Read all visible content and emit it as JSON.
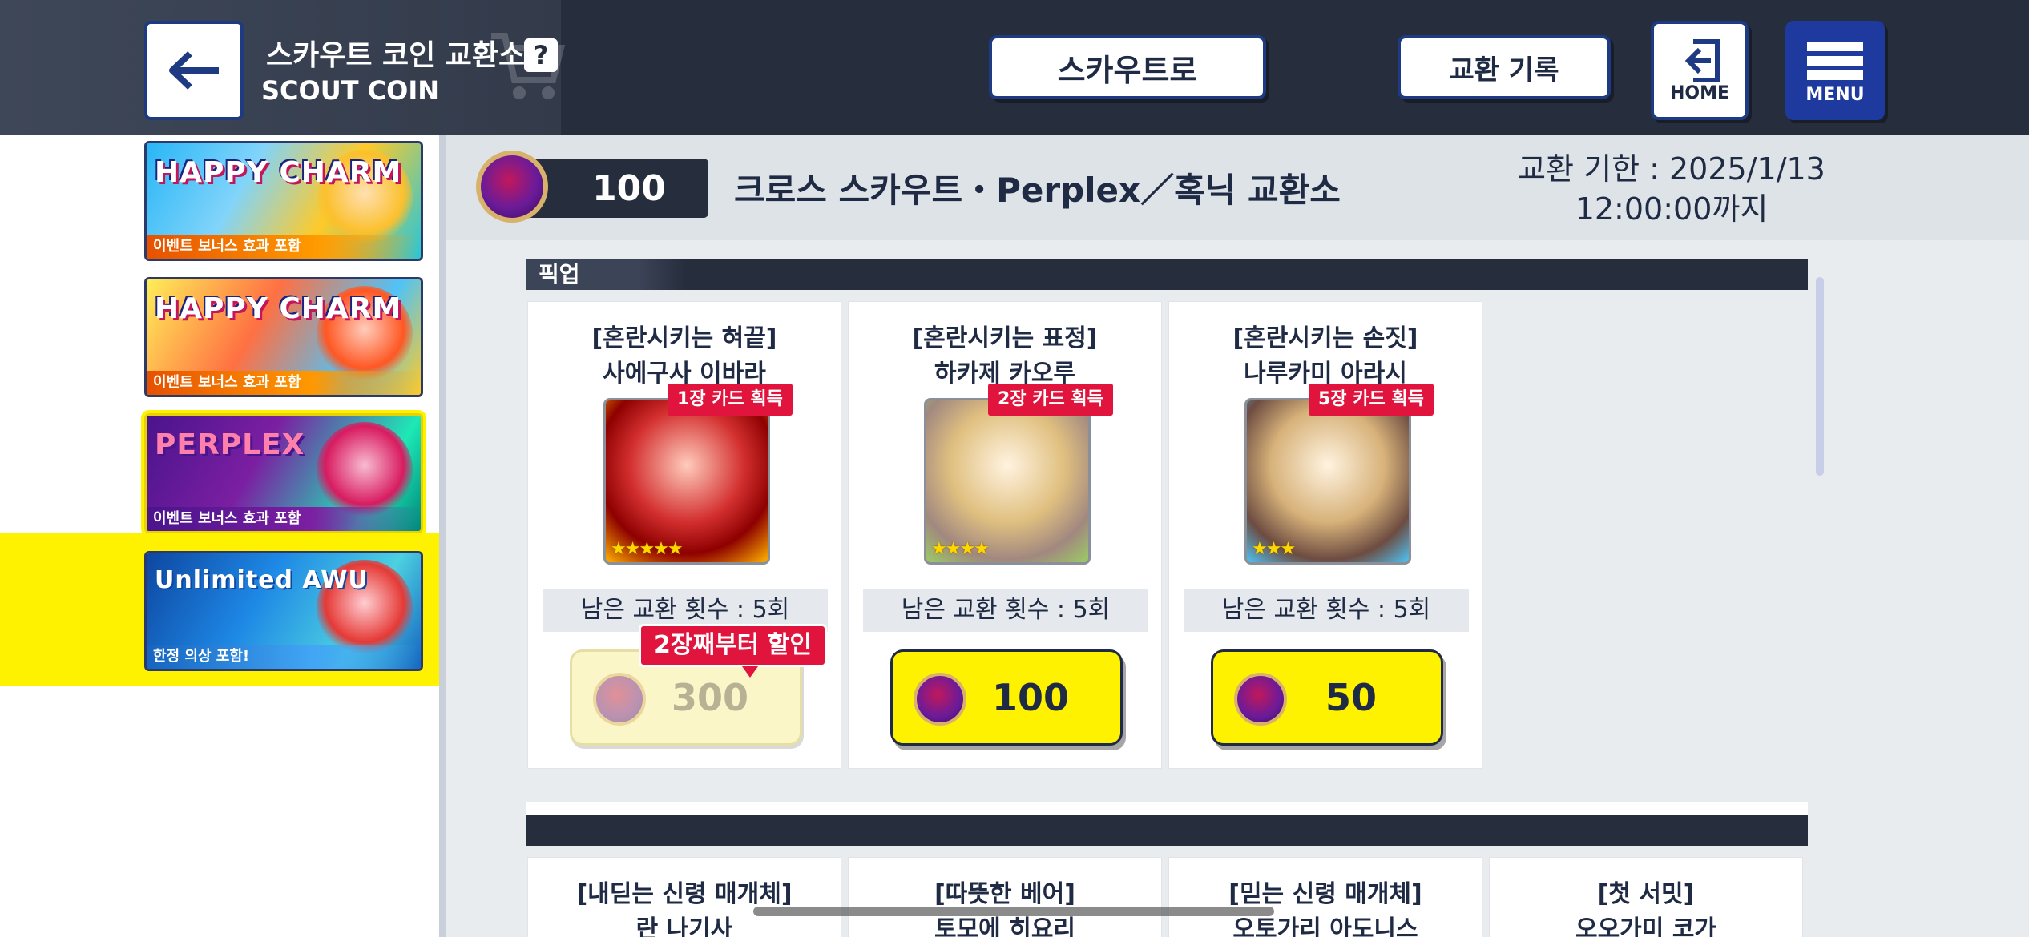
{
  "header": {
    "title_ko": "스카우트 코인 교환소",
    "title_en": "SCOUT COIN",
    "help": "?",
    "scout_button": "스카우트로",
    "history_button": "교환 기록",
    "home_button": "HOME",
    "menu_button": "MENU"
  },
  "sidebar": {
    "items": [
      {
        "name": "HAPPY CHARM",
        "label": "이벤트 보너스 효과 포함"
      },
      {
        "name": "HAPPY CHARM",
        "label": "이벤트 보너스 효과 포함"
      },
      {
        "name": "PERPLEX",
        "label": "이벤트 보너스 효과 포함",
        "selected": true
      },
      {
        "name": "Unlimited AWU",
        "label": "한정 의상 포함!"
      }
    ]
  },
  "shop": {
    "coins": "100",
    "title": "크로스 스카우트・Perplex／혹닉 교환소",
    "deadline_line1": "교환 기한 : 2025/1/13",
    "deadline_line2": "12:00:00까지"
  },
  "pickup": {
    "section_label": "픽업",
    "cards": [
      {
        "title": "[혼란시키는 혀끝]",
        "name": "사에구사 이바라",
        "badge": "1장 카드 획득",
        "stars": "★★★★★",
        "remaining": "남은 교환 횟수 : 5회",
        "price": "300",
        "disabled": true,
        "discount": "2장째부터 할인"
      },
      {
        "title": "[혼란시키는 표정]",
        "name": "하카제 카오루",
        "badge": "2장 카드 획득",
        "stars": "★★★★",
        "remaining": "남은 교환 횟수 : 5회",
        "price": "100"
      },
      {
        "title": "[혼란시키는 손짓]",
        "name": "나루카미 아라시",
        "badge": "5장 카드 획득",
        "stars": "★★★",
        "remaining": "남은 교환 횟수 : 5회",
        "price": "50"
      }
    ]
  },
  "second_section": {
    "cards": [
      {
        "title": "[내딛는 신령 매개체]",
        "name": "란 나기사"
      },
      {
        "title": "[따뜻한 베어]",
        "name": "토모에 히요리"
      },
      {
        "title": "[믿는 신령 매개체]",
        "name": "오토가리 아도니스"
      },
      {
        "title": "[첫 서밋]",
        "name": "오오가미 코가"
      }
    ]
  },
  "colors": {
    "header_bg": "#262d3d",
    "accent_yellow": "#fff200",
    "badge_red": "#e0143c",
    "nav_blue": "#1e3a82"
  }
}
